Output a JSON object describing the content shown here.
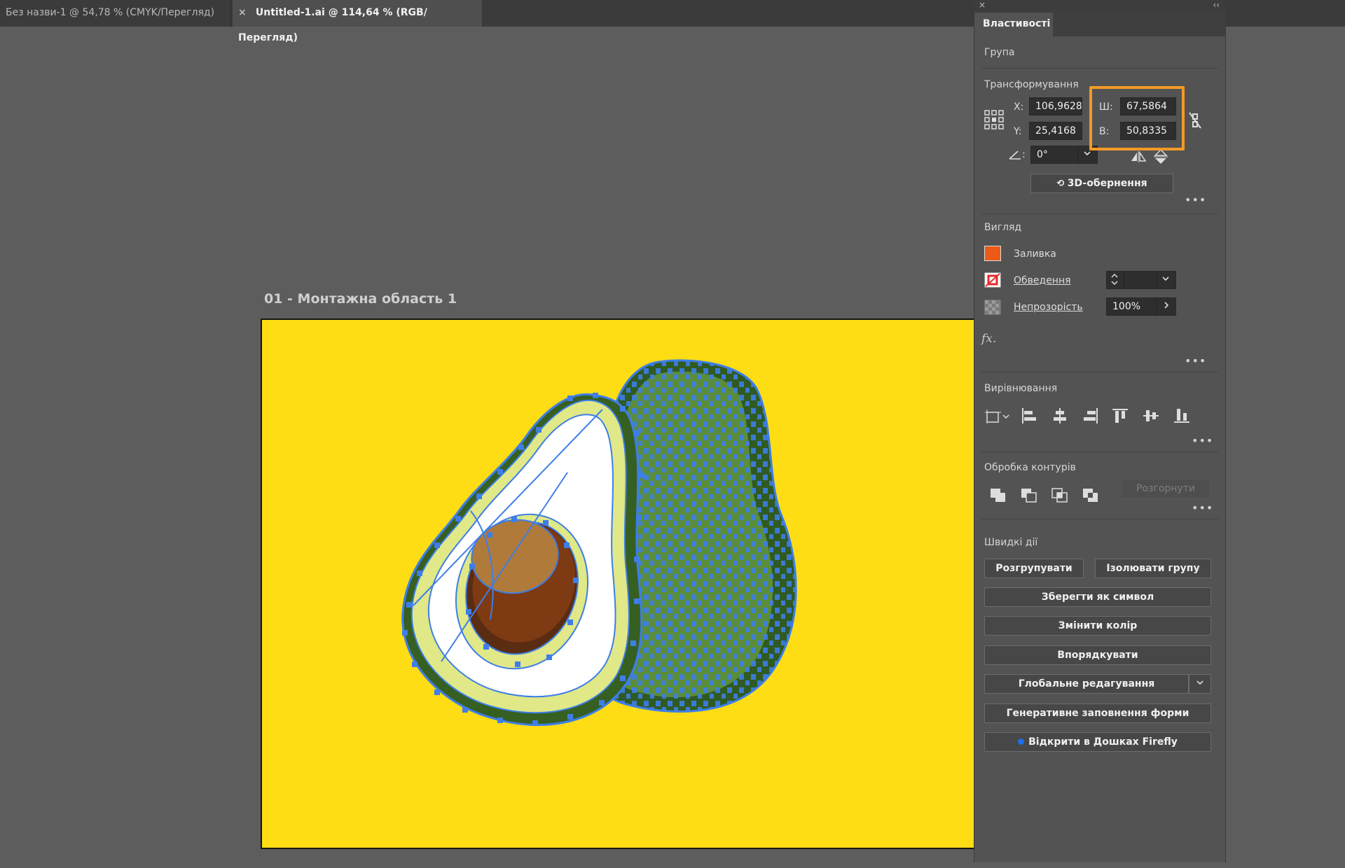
{
  "tabs": [
    {
      "label": "Без назви-1 @ 54,78 % (CMYK/Перегляд)"
    },
    {
      "label": "Untitled-1.ai @ 114,64 % (RGB/Перегляд)",
      "close": "×"
    }
  ],
  "artboard": {
    "label": "01 - Монтажна область 1"
  },
  "panel": {
    "tab": "Властивості",
    "close": "×",
    "collapse": "‹‹",
    "group_label": "Група",
    "transform": {
      "title": "Трансформування",
      "x_label": "X:",
      "x_value": "106,9628",
      "y_label": "Y:",
      "y_value": "25,4168",
      "w_label": "Ш:",
      "w_value": "67,5864",
      "h_label": "В:",
      "h_value": "50,8335",
      "angle_value": "0°",
      "rotate3d_label": "3D-обернення"
    },
    "appearance": {
      "title": "Вигляд",
      "fill_label": "Заливка",
      "fill_color": "#ec5a17",
      "stroke_label": "Обведення",
      "opacity_label": "Непрозорість",
      "opacity_value": "100%",
      "fx_label": "fx."
    },
    "align": {
      "title": "Вирівнювання"
    },
    "pathfinder": {
      "title": "Обробка контурів",
      "expand_label": "Розгорнути"
    },
    "quick_actions": {
      "title": "Швидкі дії",
      "ungroup": "Розгрупувати",
      "isolate": "Ізолювати групу",
      "save_symbol": "Зберегти як символ",
      "recolor": "Змінити колір",
      "arrange": "Впорядкувати",
      "global_edit": "Глобальне редагування",
      "generative_fill": "Генеративне заповнення форми",
      "open_firefly": "Відкрити в Дошках Firefly"
    }
  },
  "colors": {
    "artboard": "#fedd15",
    "selection": "#3d7ee8",
    "highlight": "#f39a26"
  }
}
